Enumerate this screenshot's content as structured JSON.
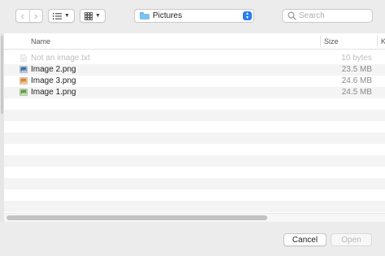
{
  "toolbar": {
    "back_glyph": "‹",
    "forward_glyph": "›",
    "location": "Pictures",
    "search_placeholder": "Search"
  },
  "columns": {
    "name": "Name",
    "size": "Size",
    "kind": "K"
  },
  "files": [
    {
      "name": "Not an image.txt",
      "size": "10 bytes",
      "icon": "text-file-icon",
      "enabled": false
    },
    {
      "name": "Image 2.png",
      "size": "23.5 MB",
      "icon": "image-file-icon",
      "enabled": true
    },
    {
      "name": "Image 3.png",
      "size": "24.6 MB",
      "icon": "image-file-icon",
      "enabled": true
    },
    {
      "name": "Image 1.png",
      "size": "24.5 MB",
      "icon": "image-file-icon",
      "enabled": true
    }
  ],
  "buttons": {
    "cancel": "Cancel",
    "open": "Open"
  },
  "colors": {
    "accent": "#2a7df0",
    "folder": "#7ec1ee"
  }
}
